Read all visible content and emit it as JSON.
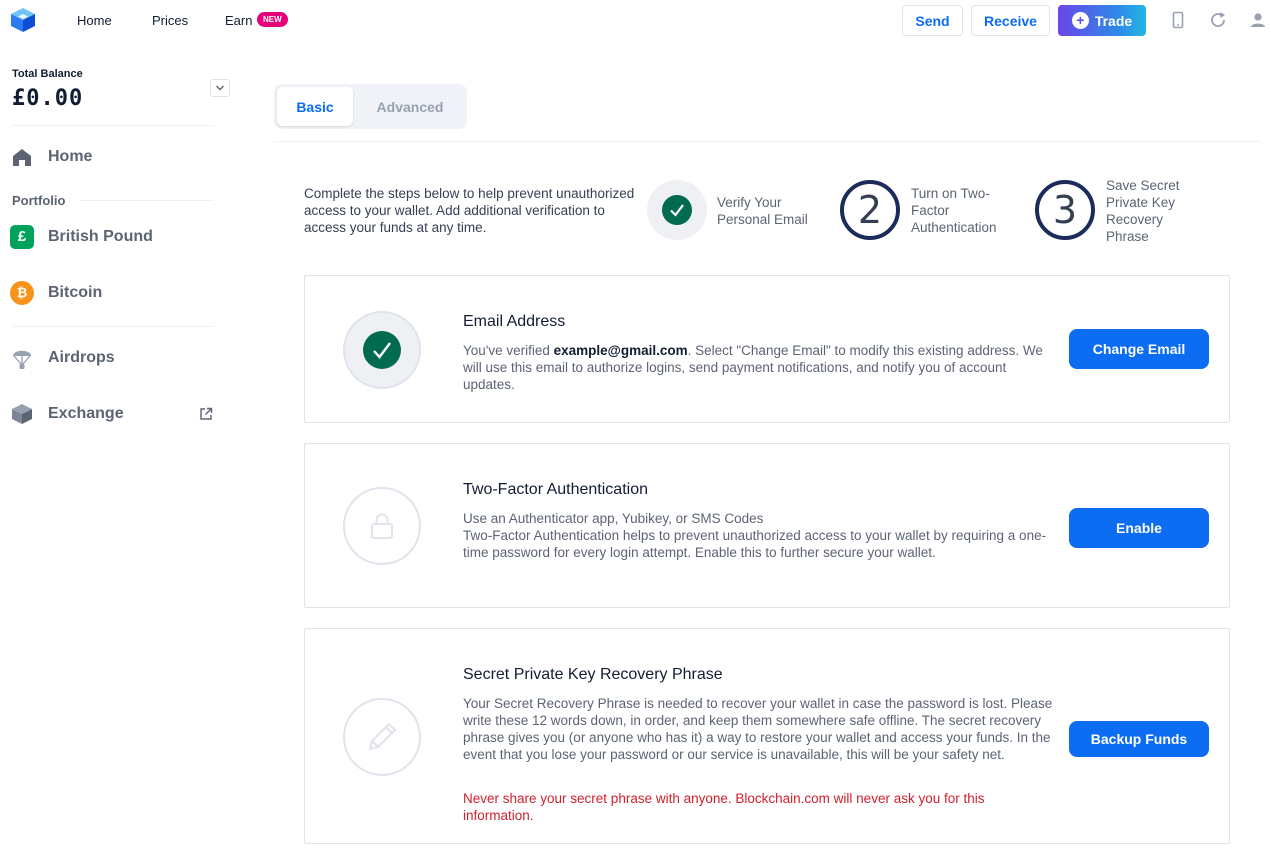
{
  "topbar": {
    "nav": [
      {
        "label": "Home"
      },
      {
        "label": "Prices"
      },
      {
        "label": "Earn"
      }
    ],
    "earn_badge": "NEW",
    "send_label": "Send",
    "receive_label": "Receive",
    "trade_label": "Trade",
    "icons": [
      "mobile-icon",
      "refresh-icon",
      "user-icon"
    ]
  },
  "sidebar": {
    "total_label": "Total Balance",
    "total_value": "£0.00",
    "home_label": "Home",
    "portfolio_label": "Portfolio",
    "assets": [
      {
        "label": "British Pound",
        "symbol": "£",
        "color": "#00a35c"
      },
      {
        "label": "Bitcoin",
        "symbol": "₿",
        "color": "#f7931a"
      }
    ],
    "airdrops_label": "Airdrops",
    "exchange_label": "Exchange"
  },
  "tabs": {
    "basic": "Basic",
    "advanced": "Advanced"
  },
  "intro": "Complete the steps below to help prevent unauthorized access to your wallet. Add additional verification to access your funds at any time.",
  "steps": [
    {
      "label": "Verify Your Personal Email"
    },
    {
      "number": "2",
      "label": "Turn on Two-Factor Authentication"
    },
    {
      "number": "3",
      "label": "Save Secret Private Key Recovery Phrase"
    }
  ],
  "cards": {
    "email": {
      "title": "Email Address",
      "text_prefix": "You've verified ",
      "email": "example@gmail.com",
      "text_suffix": ". Select \"Change Email\" to modify this existing address. We will use this email to authorize logins, send payment notifications, and notify you of account updates.",
      "button": "Change Email"
    },
    "twofa": {
      "title": "Two-Factor Authentication",
      "line1": "Use an Authenticator app, Yubikey, or SMS Codes",
      "line2": "Two-Factor Authentication helps to prevent unauthorized access to your wallet by requiring a one-time password for every login attempt. Enable this to further secure your wallet.",
      "button": "Enable"
    },
    "phrase": {
      "title": "Secret Private Key Recovery Phrase",
      "text": "Your Secret Recovery Phrase is needed to recover your wallet in case the password is lost. Please write these 12 words down, in order, and keep them somewhere safe offline. The secret recovery phrase gives you (or anyone who has it) a way to restore your wallet and access your funds. In the event that you lose your password or our service is unavailable, this will be your safety net.",
      "warning": "Never share your secret phrase with anyone. Blockchain.com will never ask you for this information.",
      "button": "Backup Funds"
    }
  },
  "colors": {
    "brand_blue": "#0c6cf2",
    "verified_green": "#006b4f",
    "warning_red": "#d0202e",
    "step_ring": "#1b2b5a"
  }
}
